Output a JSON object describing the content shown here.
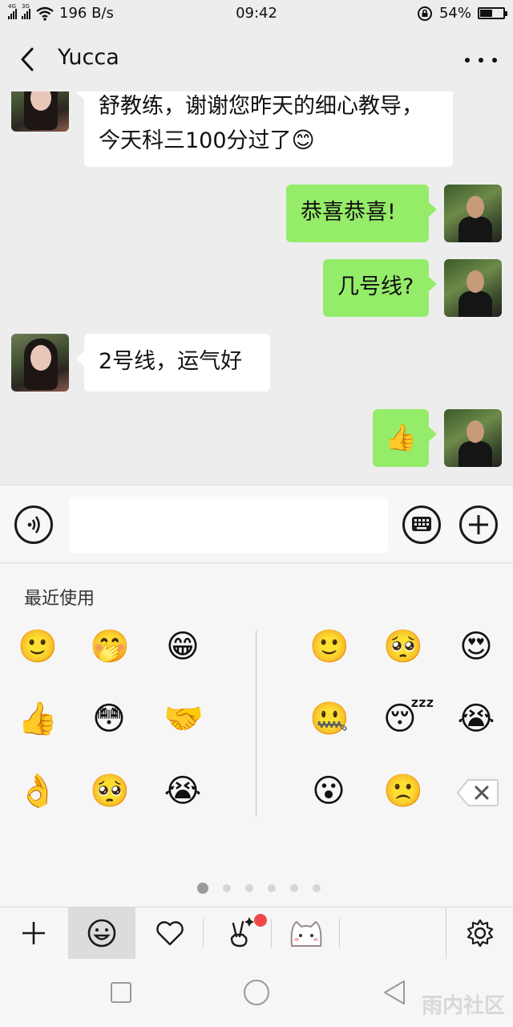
{
  "status_bar": {
    "network_1": "4G",
    "network_2": "3G",
    "speed": "196 B/s",
    "time": "09:42",
    "battery_percent": "54%",
    "battery_level": 0.54
  },
  "header": {
    "back_icon": "chevron-left-icon",
    "title": "Yucca",
    "more_icon": "more-dots-icon"
  },
  "messages": [
    {
      "side": "left",
      "text": "舒教练，谢谢您昨天的细心教导，\n今天科三100分过了",
      "emoji": "😊"
    },
    {
      "side": "right",
      "text": "恭喜恭喜!"
    },
    {
      "side": "right",
      "text": "几号线?"
    },
    {
      "side": "left",
      "text": "2号线，运气好"
    },
    {
      "side": "right",
      "emoji": "👍"
    }
  ],
  "input_bar": {
    "voice_icon": "voice-icon",
    "input_value": "",
    "keyboard_icon": "keyboard-icon",
    "add_icon": "plus-circle-icon"
  },
  "emoji_panel": {
    "section_label": "最近使用",
    "recent": [
      "🙂",
      "🤭",
      "😁",
      "👍",
      "😳",
      "🤝",
      "👌",
      "🥺",
      "😭"
    ],
    "all": [
      "🙂",
      "🥺",
      "😍",
      "🤐",
      "😴",
      "😭",
      "😮",
      "🙁"
    ],
    "delete_icon": "backspace-icon",
    "pages": 6,
    "active_page": 1
  },
  "emoji_tabs": [
    {
      "name": "add-icon",
      "glyph": "+"
    },
    {
      "name": "smiley-icon",
      "glyph": "☺"
    },
    {
      "name": "heart-icon",
      "glyph": "♡"
    },
    {
      "name": "victory-hand-icon",
      "glyph": "✌"
    },
    {
      "name": "cat-sticker-icon",
      "glyph": "🐱"
    }
  ],
  "settings_icon": "gear-icon",
  "nav_bar": {
    "recents_icon": "square-icon",
    "home_icon": "circle-icon",
    "back_icon": "triangle-back-icon"
  },
  "watermark": "雨内社区"
}
